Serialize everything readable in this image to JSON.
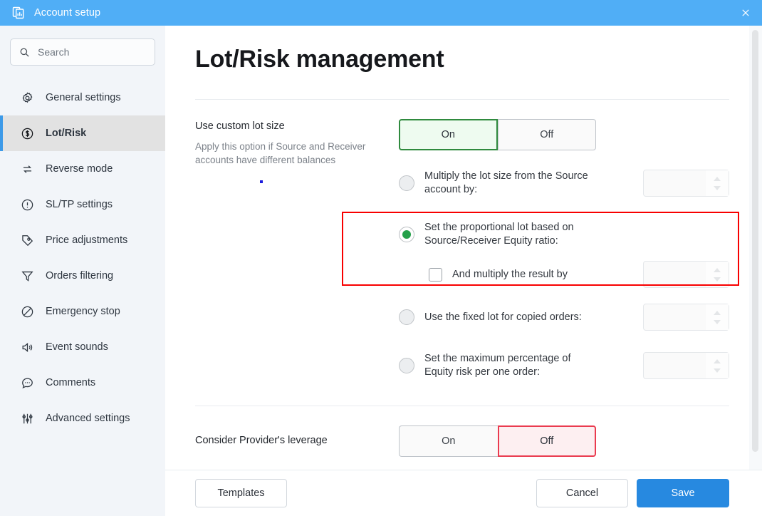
{
  "window": {
    "title": "Account setup",
    "icon": "app-window-icon",
    "close_label": "×",
    "accent": "#50aef6"
  },
  "sidebar": {
    "search": {
      "value": "",
      "placeholder": "Search",
      "icon": "search-icon"
    },
    "items": [
      {
        "label": "General settings",
        "icon": "gear-icon",
        "active": false
      },
      {
        "label": "Lot/Risk",
        "icon": "dollar-coin-icon",
        "active": true
      },
      {
        "label": "Reverse mode",
        "icon": "swap-arrows-icon",
        "active": false
      },
      {
        "label": "SL/TP settings",
        "icon": "alert-circle-icon",
        "active": false
      },
      {
        "label": "Price adjustments",
        "icon": "tag-icon",
        "active": false
      },
      {
        "label": "Orders filtering",
        "icon": "funnel-icon",
        "active": false
      },
      {
        "label": "Emergency stop",
        "icon": "no-entry-icon",
        "active": false
      },
      {
        "label": "Event sounds",
        "icon": "speaker-icon",
        "active": false
      },
      {
        "label": "Comments",
        "icon": "chat-bubble-icon",
        "active": false
      },
      {
        "label": "Advanced settings",
        "icon": "sliders-icon",
        "active": false
      }
    ]
  },
  "main": {
    "page_title": "Lot/Risk management",
    "custom_lot": {
      "label": "Use custom lot size",
      "description": "Apply this option if Source and Receiver accounts have different balances",
      "toggle": {
        "on_label": "On",
        "off_label": "Off",
        "selected": "On",
        "selected_color": "#2f8a3e"
      }
    },
    "options": [
      {
        "id": "multiply-source",
        "text": "Multiply the lot size from the Source account by:",
        "selected": false,
        "input": {
          "value": "",
          "placeholder": ""
        }
      },
      {
        "id": "proportional-equity",
        "text": "Set the proportional lot based on Source/Receiver Equity ratio:",
        "selected": true,
        "highlighted": true,
        "sub_option": {
          "id": "and-multiply-result",
          "text": "And multiply the result by",
          "checked": false,
          "input": {
            "value": "",
            "placeholder": ""
          }
        }
      },
      {
        "id": "fixed-lot",
        "text": "Use the fixed lot for copied orders:",
        "selected": false,
        "input": {
          "value": "",
          "placeholder": ""
        }
      },
      {
        "id": "max-equity-risk",
        "text": "Set the maximum percentage of Equity risk per one order:",
        "selected": false,
        "input": {
          "value": "",
          "placeholder": ""
        }
      }
    ],
    "provider_leverage": {
      "label": "Consider Provider's leverage",
      "toggle": {
        "on_label": "On",
        "off_label": "Off",
        "selected": "Off",
        "selected_color": "#ea3b4f"
      }
    },
    "highlight_color": "#f80000"
  },
  "footer": {
    "templates_label": "Templates",
    "cancel_label": "Cancel",
    "save_label": "Save",
    "save_color": "#2789e0"
  }
}
